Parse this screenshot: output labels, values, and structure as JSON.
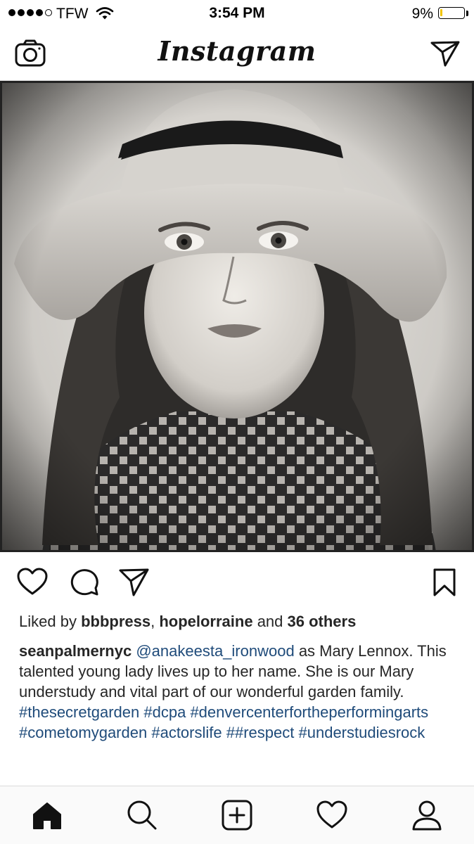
{
  "status_bar": {
    "carrier": "TFW",
    "time": "3:54 PM",
    "battery_pct": "9%",
    "battery_level": 0.09,
    "signal_bars": 4
  },
  "header": {
    "logo": "Instagram"
  },
  "post": {
    "liked_prefix": "Liked by ",
    "liked_user1": "bbbpress",
    "liked_sep": ", ",
    "liked_user2": "hopelorraine",
    "liked_and": " and ",
    "liked_count": "36 others",
    "caption_user": "seanpalmernyc",
    "mention": "@anakeesta_ironwood",
    "caption_text": " as Mary Lennox.  This talented young lady lives up to her name.  She is our Mary understudy and vital part of our wonderful garden family.  ",
    "hashtags": [
      "#thesecretgarden",
      "#dcpa",
      "#denvercenterfortheperformingarts",
      "#cometomygarden",
      "#actorslife",
      "##respect",
      "#understudiesrock"
    ]
  },
  "icons": {
    "header": [
      "camera-icon",
      "direct-message-icon"
    ],
    "actions": [
      "heart-icon",
      "comment-icon",
      "share-icon",
      "bookmark-icon"
    ],
    "tabs": [
      "home-icon",
      "search-icon",
      "add-post-icon",
      "activity-heart-icon",
      "profile-icon"
    ]
  },
  "colors": {
    "hashtag": "#1f4b7a",
    "battery": "#f2c500",
    "divider": "#dbdbdb"
  }
}
